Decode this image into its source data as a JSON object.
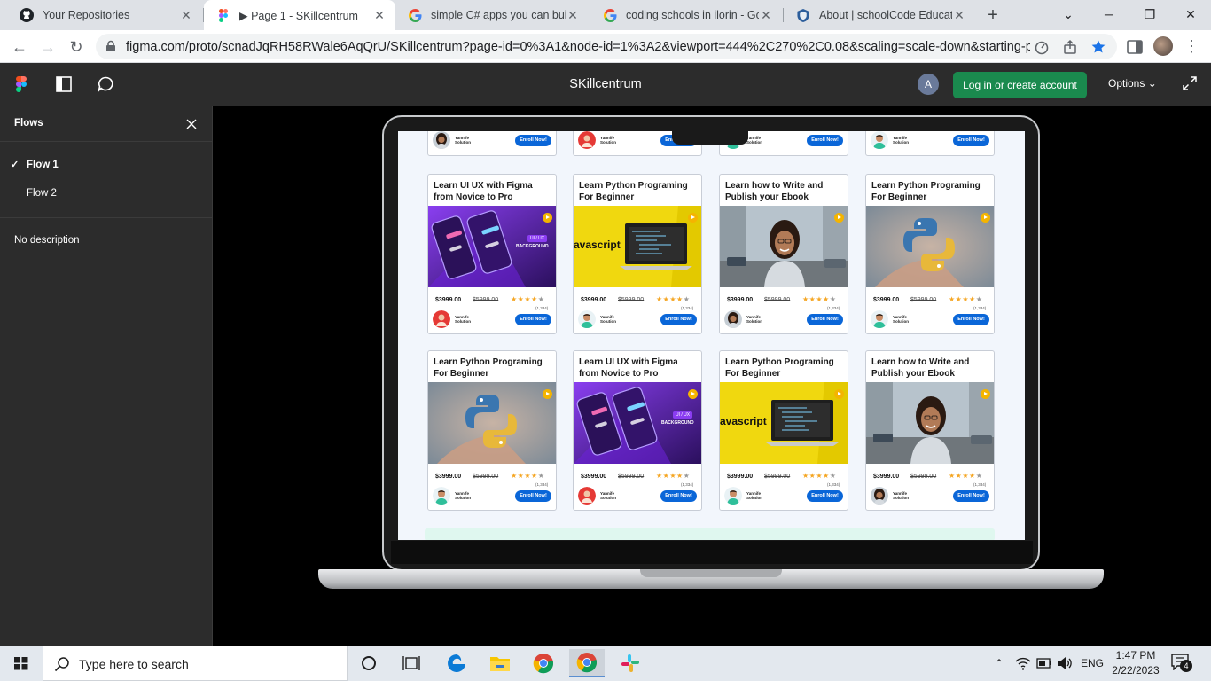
{
  "browser": {
    "tabs": [
      {
        "title": "Your Repositories",
        "icon": "github-icon",
        "active": false
      },
      {
        "title": "▶ Page 1 - SKillcentrum",
        "icon": "figma-icon",
        "active": true
      },
      {
        "title": "simple C# apps you can build",
        "icon": "google-icon",
        "active": false
      },
      {
        "title": "coding schools in ilorin - Goo",
        "icon": "google-icon",
        "active": false
      },
      {
        "title": "About | schoolCode Educatio",
        "icon": "shield-icon",
        "active": false
      }
    ],
    "url": "figma.com/proto/scnadJqRH58RWale6AqQrU/SKillcentrum?page-id=0%3A1&node-id=1%3A2&viewport=444%2C270%2C0.08&scaling=scale-down&starting-poi..."
  },
  "figma": {
    "title": "SKillcentrum",
    "avatar_letter": "A",
    "login_label": "Log in or create account",
    "options_label": "Options"
  },
  "sidebar": {
    "title": "Flows",
    "flows": [
      {
        "label": "Flow 1",
        "selected": true
      },
      {
        "label": "Flow 2",
        "selected": false
      }
    ],
    "description": "No description"
  },
  "courses": {
    "author": "Yannife Solution",
    "enroll_label": "Enroll Now!",
    "top_row": [
      {
        "avatar": "woman"
      },
      {
        "avatar": "red"
      },
      {
        "avatar": "man"
      },
      {
        "avatar": "man"
      }
    ],
    "items": [
      {
        "title": "Learn UI UX with Figma from Novice to Pro",
        "image": "uiux",
        "price": "$3999.00",
        "old_price": "$5999.00",
        "rating_count": "(1,334)",
        "avatar": "red"
      },
      {
        "title": "Learn Python Programing For Beginner",
        "image": "javascript",
        "price": "$3999.00",
        "old_price": "$5999.00",
        "rating_count": "(1,334)",
        "avatar": "man"
      },
      {
        "title": "Learn how to Write and Publish your Ebook",
        "image": "woman",
        "price": "$3999.00",
        "old_price": "$5999.00",
        "rating_count": "(1,334)",
        "avatar": "woman"
      },
      {
        "title": "Learn Python Programing For Beginner",
        "image": "python",
        "price": "$3999.00",
        "old_price": "$5999.00",
        "rating_count": "(1,334)",
        "avatar": "man"
      },
      {
        "title": "Learn Python Programing For Beginner",
        "image": "python",
        "price": "$3999.00",
        "old_price": "$5999.00",
        "rating_count": "(1,334)",
        "avatar": "man"
      },
      {
        "title": "Learn UI UX with Figma from Novice to Pro",
        "image": "uiux",
        "price": "$3999.00",
        "old_price": "$5999.00",
        "rating_count": "(1,334)",
        "avatar": "red"
      },
      {
        "title": "Learn Python Programing For Beginner",
        "image": "javascript",
        "price": "$3999.00",
        "old_price": "$5999.00",
        "rating_count": "(1,334)",
        "avatar": "man"
      },
      {
        "title": "Learn how to Write and Publish your Ebook",
        "image": "woman",
        "price": "$3999.00",
        "old_price": "$5999.00",
        "rating_count": "(1,334)",
        "avatar": "woman"
      }
    ],
    "image_text": {
      "javascript": "avascript",
      "uiux_badge": "UI / UX",
      "uiux_caption": "BACKGROUND"
    }
  },
  "taskbar": {
    "search_placeholder": "Type here to search",
    "language": "ENG",
    "time": "1:47 PM",
    "date": "2/22/2023",
    "notification_count": "4"
  }
}
